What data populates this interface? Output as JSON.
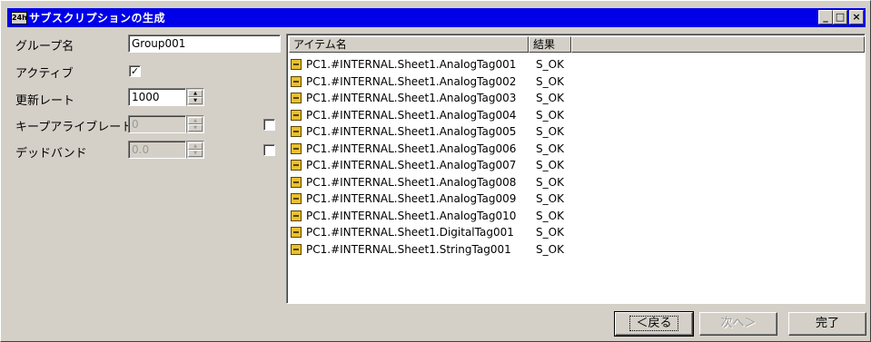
{
  "window": {
    "title": "サブスクリプションの生成",
    "app_icon": "app-icon",
    "minimize": "_",
    "maximize": "□",
    "close": "×"
  },
  "form": {
    "group_name_label": "グループ名",
    "group_name_value": "Group001",
    "active_label": "アクティブ",
    "active_checked": "✓",
    "update_rate_label": "更新レート",
    "update_rate_value": "1000",
    "keep_alive_label": "キープアライブレート",
    "keep_alive_value": "0",
    "deadband_label": "デッドバンド",
    "deadband_value": "0.0"
  },
  "list": {
    "columns": [
      "アイテム名",
      "結果"
    ],
    "rows": [
      {
        "item": "PC1.#INTERNAL.Sheet1.AnalogTag001",
        "result": "S_OK"
      },
      {
        "item": "PC1.#INTERNAL.Sheet1.AnalogTag002",
        "result": "S_OK"
      },
      {
        "item": "PC1.#INTERNAL.Sheet1.AnalogTag003",
        "result": "S_OK"
      },
      {
        "item": "PC1.#INTERNAL.Sheet1.AnalogTag004",
        "result": "S_OK"
      },
      {
        "item": "PC1.#INTERNAL.Sheet1.AnalogTag005",
        "result": "S_OK"
      },
      {
        "item": "PC1.#INTERNAL.Sheet1.AnalogTag006",
        "result": "S_OK"
      },
      {
        "item": "PC1.#INTERNAL.Sheet1.AnalogTag007",
        "result": "S_OK"
      },
      {
        "item": "PC1.#INTERNAL.Sheet1.AnalogTag008",
        "result": "S_OK"
      },
      {
        "item": "PC1.#INTERNAL.Sheet1.AnalogTag009",
        "result": "S_OK"
      },
      {
        "item": "PC1.#INTERNAL.Sheet1.AnalogTag010",
        "result": "S_OK"
      },
      {
        "item": "PC1.#INTERNAL.Sheet1.DigitalTag001",
        "result": "S_OK"
      },
      {
        "item": "PC1.#INTERNAL.Sheet1.StringTag001",
        "result": "S_OK"
      }
    ]
  },
  "buttons": {
    "back": "＜戻る",
    "next": "次へ＞",
    "finish": "完了"
  }
}
